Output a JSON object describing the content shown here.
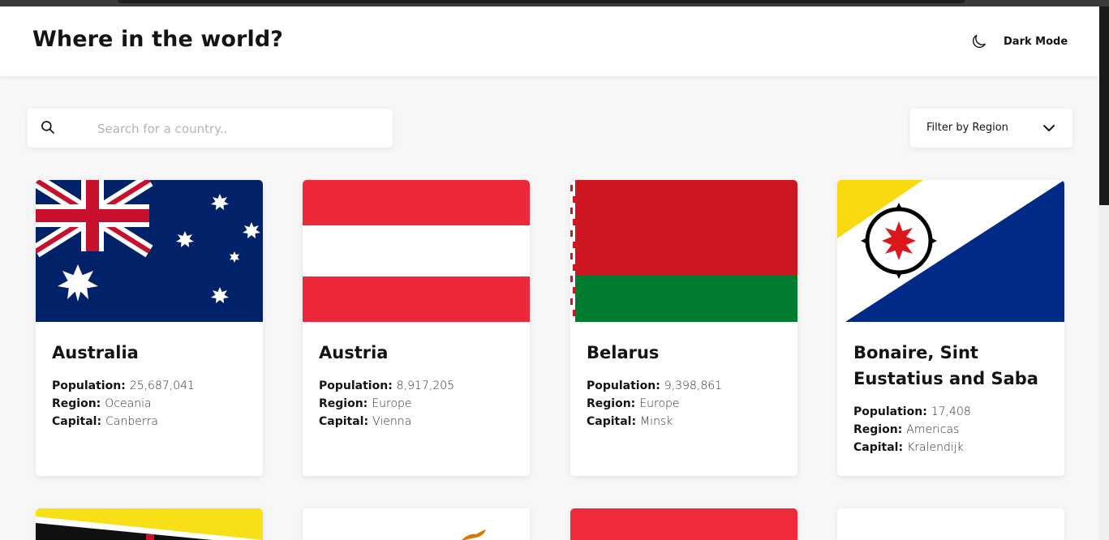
{
  "header": {
    "title": "Where in the world?",
    "theme_toggle_label": "Dark Mode",
    "theme_icon": "moon-icon"
  },
  "search": {
    "placeholder": "Search for a country..",
    "value": ""
  },
  "filter": {
    "label": "Filter by Region",
    "icon": "chevron-down-icon"
  },
  "labels": {
    "population": "Population:",
    "region": "Region:",
    "capital": "Capital:"
  },
  "countries": [
    {
      "name": "Australia",
      "population": "25,687,041",
      "region": "Oceania",
      "capital": "Canberra"
    },
    {
      "name": "Austria",
      "population": "8,917,205",
      "region": "Europe",
      "capital": "Vienna"
    },
    {
      "name": "Belarus",
      "population": "9,398,861",
      "region": "Europe",
      "capital": "Minsk"
    },
    {
      "name": "Bonaire, Sint Eustatius and Saba",
      "population": "17,408",
      "region": "Americas",
      "capital": "Kralendijk"
    }
  ],
  "colors": {
    "text": "#111517",
    "background": "#f7f7f7",
    "card": "#ffffff",
    "placeholder": "#b5b5b5"
  }
}
